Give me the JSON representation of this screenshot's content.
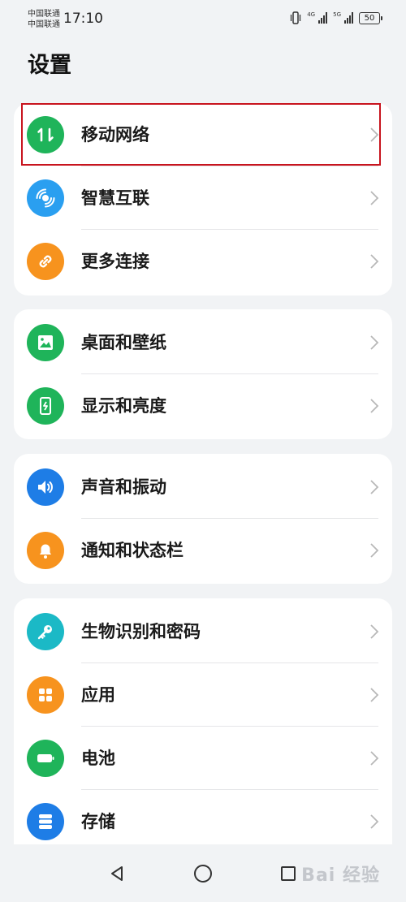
{
  "status_bar": {
    "carrier_1": "中国联通",
    "carrier_2": "中国联通",
    "time": "17:10",
    "sim1_network": "4G",
    "sim2_network": "5G",
    "battery": "50"
  },
  "page_title": "设置",
  "groups": [
    {
      "items": [
        {
          "label": "移动网络",
          "icon": "mobile-data-icon",
          "color": "#1fb45a"
        },
        {
          "label": "智慧互联",
          "icon": "smart-connect-icon",
          "color": "#2a9ff0"
        },
        {
          "label": "更多连接",
          "icon": "link-icon",
          "color": "#f7931e"
        }
      ]
    },
    {
      "items": [
        {
          "label": "桌面和壁纸",
          "icon": "wallpaper-icon",
          "color": "#1fb45a"
        },
        {
          "label": "显示和亮度",
          "icon": "display-brightness-icon",
          "color": "#1fb45a"
        }
      ]
    },
    {
      "items": [
        {
          "label": "声音和振动",
          "icon": "speaker-icon",
          "color": "#1e7de6"
        },
        {
          "label": "通知和状态栏",
          "icon": "bell-icon",
          "color": "#f7931e"
        }
      ]
    },
    {
      "items": [
        {
          "label": "生物识别和密码",
          "icon": "key-icon",
          "color": "#1bb9c6"
        },
        {
          "label": "应用",
          "icon": "apps-grid-icon",
          "color": "#f7931e"
        },
        {
          "label": "电池",
          "icon": "battery-icon",
          "color": "#1fb45a"
        },
        {
          "label": "存储",
          "icon": "storage-icon",
          "color": "#1e7de6"
        }
      ]
    }
  ],
  "highlighted_item": "移动网络",
  "watermark": "Bai 经验"
}
